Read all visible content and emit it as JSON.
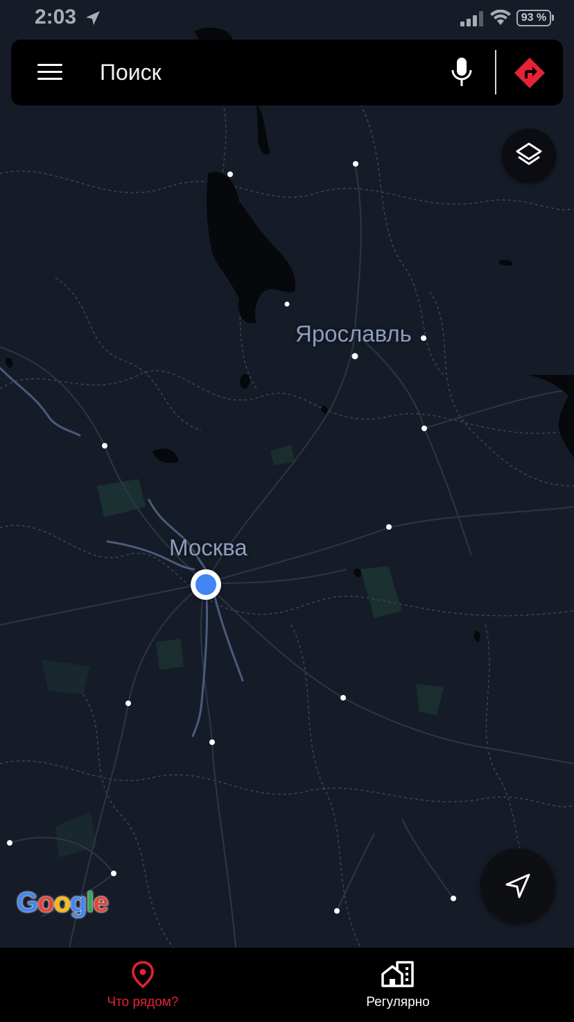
{
  "status_bar": {
    "time": "2:03",
    "battery": "93 %"
  },
  "search": {
    "placeholder": "Поиск",
    "menu_icon": "hamburger-menu-icon",
    "mic_icon": "microphone-icon",
    "directions_icon": "directions-icon"
  },
  "map": {
    "labels": {
      "yaroslavl": "Ярославль",
      "moscow": "Москва"
    },
    "attribution": {
      "G": "G",
      "o1": "o",
      "o2": "o",
      "g": "g",
      "l": "l",
      "e": "e"
    }
  },
  "controls": {
    "layers_icon": "layers-icon",
    "recenter_icon": "navigation-arrow-icon"
  },
  "bottom_nav": {
    "nearby_label": "Что рядом?",
    "regular_label": "Регулярно"
  },
  "colors": {
    "accent": "#e52236",
    "map_background": "#161c27",
    "label": "#8e9cbd",
    "location_dot": "#4285f4",
    "water": "#000000"
  }
}
